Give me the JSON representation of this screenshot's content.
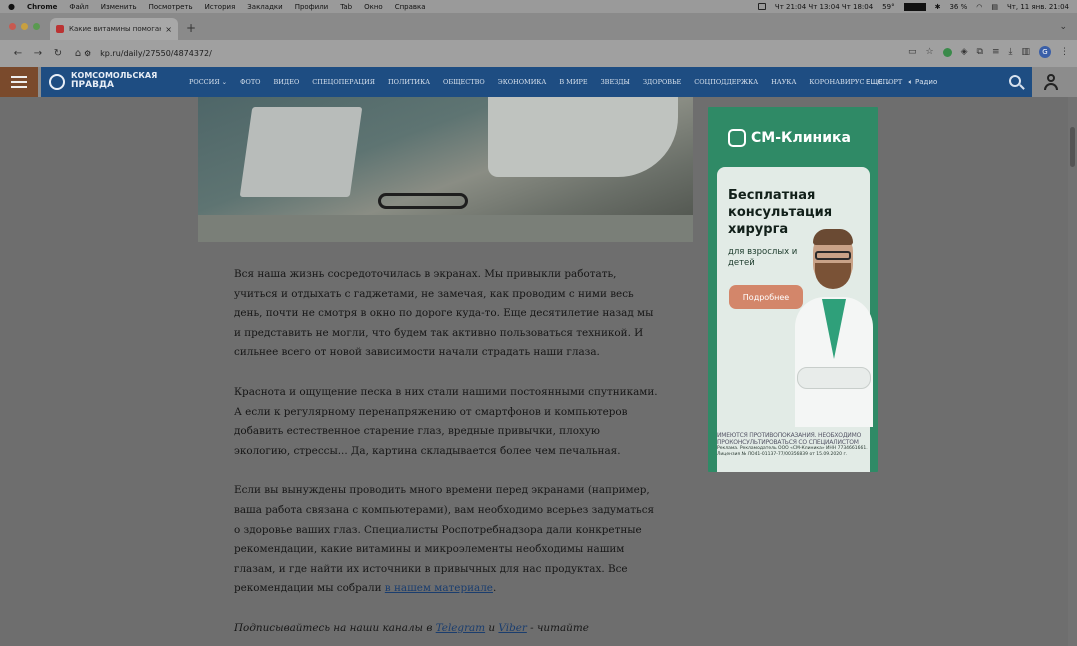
{
  "menubar": {
    "app": "Chrome",
    "items": [
      "Файл",
      "Изменить",
      "Посмотреть",
      "История",
      "Закладки",
      "Профили",
      "Tab",
      "Окно",
      "Справка"
    ],
    "status_times": "Чт 21:04  Чт 13:04  Чт 18:04",
    "temperature": "59°",
    "battery": "36 %",
    "clock": "Чт, 11 янв.  21:04"
  },
  "browser": {
    "tab_title": "Какие витамины помогают",
    "url": "kp.ru/daily/27550/4874372/"
  },
  "site": {
    "logo_line1": "КОМСОМОЛЬСКАЯ",
    "logo_line2": "ПРАВДА",
    "region": "РОССИЯ",
    "nav": [
      "ФОТО",
      "ВИДЕО",
      "СПЕЦОПЕРАЦИЯ",
      "ПОЛИТИКА",
      "ОБЩЕСТВО",
      "ЭКОНОМИКА",
      "В МИРЕ",
      "ЗВЕЗДЫ",
      "ЗДОРОВЬЕ",
      "СОЦПОДДЕРЖКА",
      "НАУКА",
      "КОРОНАВИРУС",
      "СПОРТ"
    ],
    "more": "ЕЩЕ",
    "radio": "Радио"
  },
  "article": {
    "p1": "Вся наша жизнь сосредоточилась в экранах. Мы привыкли работать, учиться и отдыхать с гаджетами, не замечая, как проводим с ними весь день, почти не смотря в окно по дороге куда-то. Еще десятилетие назад мы и представить не могли, что будем так активно пользоваться техникой. И сильнее всего от новой зависимости начали страдать наши глаза.",
    "p2": "Краснота и ощущение песка в них стали нашими постоянными спутниками. А если к регулярному перенапряжению от смартфонов и компьютеров добавить естественное старение глаз, вредные привычки, плохую экологию, стрессы... Да, картина складывается более чем печальная.",
    "p3_text": "Если вы вынуждены проводить много времени перед экранами (например, ваша работа связана с компьютерами), вам необходимо всерьез задуматься о здоровье ваших глаз. Специалисты Роспотребнадзора дали конкретные рекомендации, какие витамины и микроэлементы необходимы нашим глазам, и где найти их источники в привычных для нас продуктах. Все рекомендации мы собрали ",
    "p3_link": "в нашем материале",
    "p3_end": ".",
    "p4_start": "Подписывайтесь на наши каналы в ",
    "p4_link1": "Telegram",
    "p4_and": " и ",
    "p4_link2": "Viber",
    "p4_end": " - читайте"
  },
  "ad": {
    "brand": "СМ-Клиника",
    "headline": "Бесплатная консультация хирурга",
    "sub": "для взрослых и детей",
    "button": "Подробнее",
    "warning": "ИМЕЮТСЯ ПРОТИВОПОКАЗАНИЯ. НЕОБХОДИМО ПРОКОНСУЛЬТИРОВАТЬСЯ СО СПЕЦИАЛИСТОМ",
    "legal": "Реклама. Рекламодатель ООО «СМ-Клиника» ИНН 7734661661. Лицензия № ЛО41-01137-77/00356839 от 15.09.2020 г."
  },
  "colors": {
    "header_blue": "#1e4d82",
    "ad_green": "#2f8a66",
    "ad_button": "#d3866a",
    "link": "#1a3d6e"
  }
}
